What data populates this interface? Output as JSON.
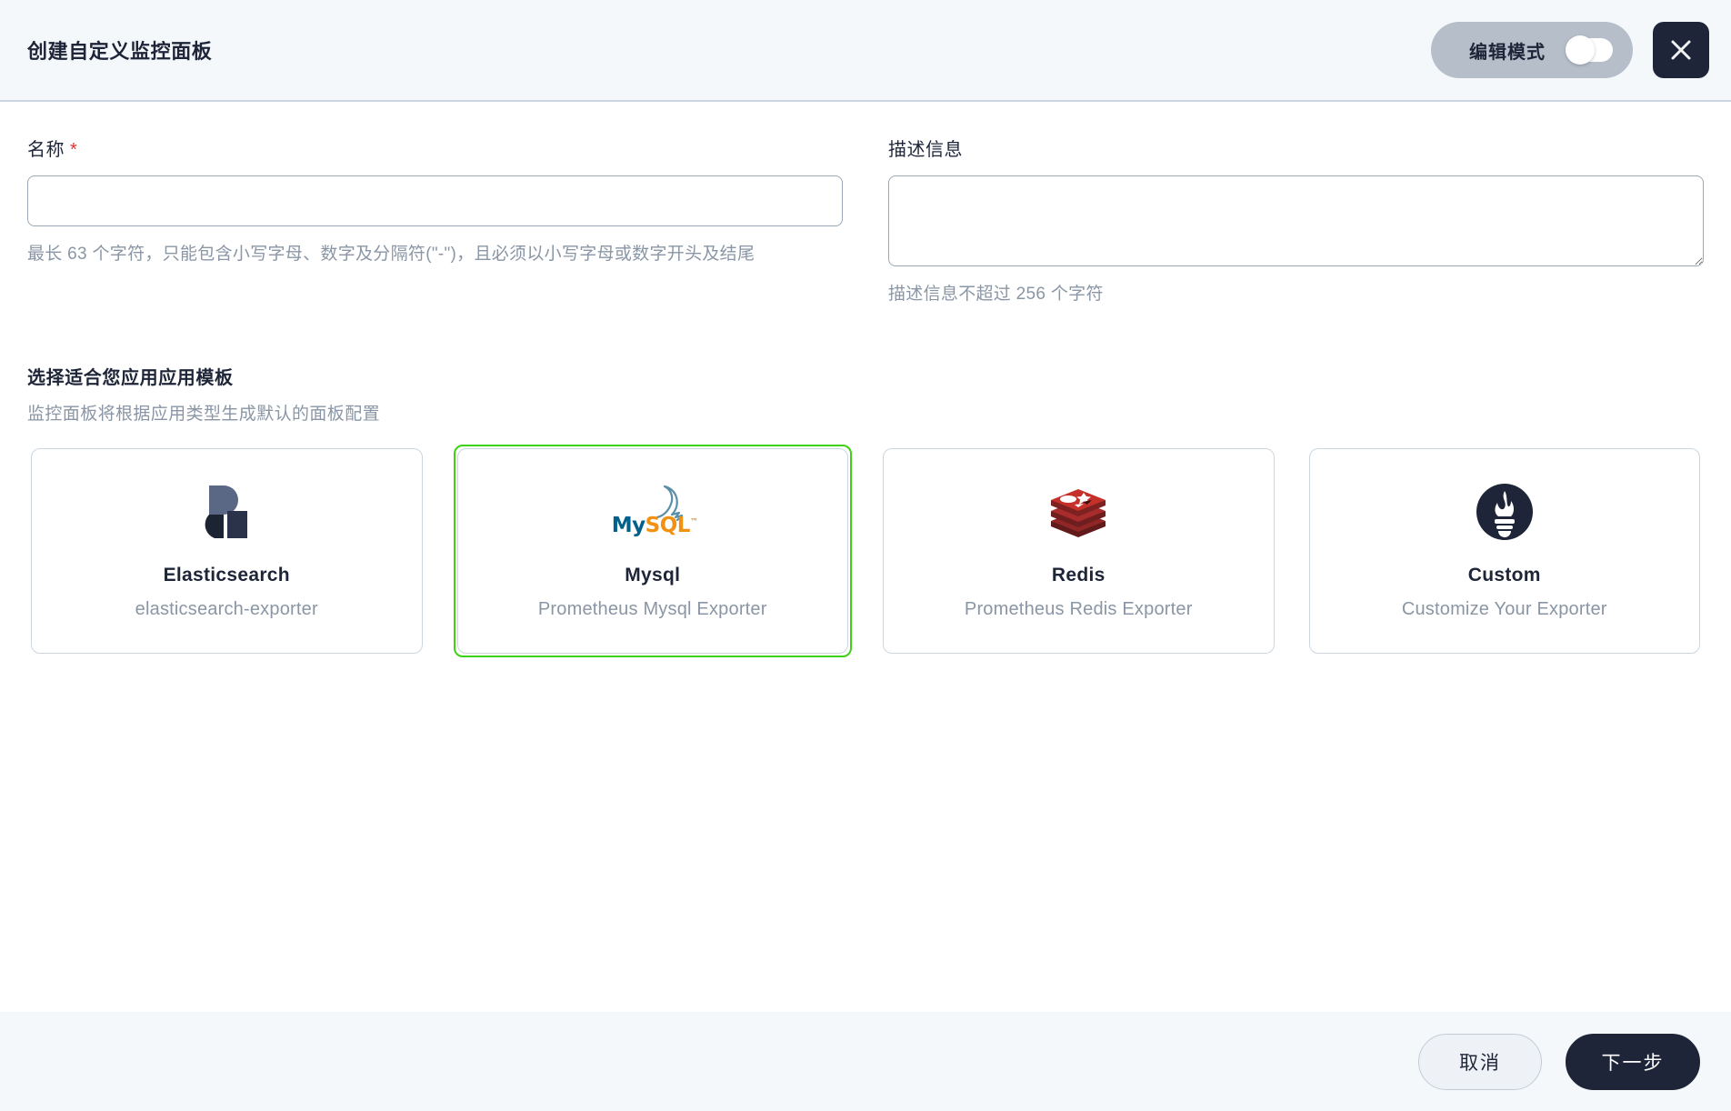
{
  "header": {
    "title": "创建自定义监控面板",
    "edit_mode_label": "编辑模式",
    "edit_mode_enabled": false,
    "close_icon": "close-icon"
  },
  "form": {
    "name": {
      "label": "名称",
      "required_marker": "*",
      "value": "",
      "placeholder": "",
      "helper": "最长 63 个字符，只能包含小写字母、数字及分隔符(\"-\")，且必须以小写字母或数字开头及结尾"
    },
    "description": {
      "label": "描述信息",
      "value": "",
      "placeholder": "",
      "helper": "描述信息不超过 256 个字符"
    }
  },
  "templates": {
    "section_title": "选择适合您应用应用模板",
    "section_subtitle": "监控面板将根据应用类型生成默认的面板配置",
    "selected_index": 1,
    "selection_color": "#3fd114",
    "items": [
      {
        "name": "Elasticsearch",
        "description": "elasticsearch-exporter",
        "logo": "elasticsearch-logo",
        "selected": false
      },
      {
        "name": "Mysql",
        "description": "Prometheus Mysql Exporter",
        "logo": "mysql-logo",
        "logo_text_primary": "My",
        "logo_text_secondary": "SQL",
        "logo_text_tm": "™",
        "selected": true
      },
      {
        "name": "Redis",
        "description": "Prometheus Redis Exporter",
        "logo": "redis-logo",
        "selected": false
      },
      {
        "name": "Custom",
        "description": "Customize Your Exporter",
        "logo": "prometheus-logo",
        "selected": false
      }
    ]
  },
  "footer": {
    "cancel_label": "取消",
    "next_label": "下一步"
  },
  "colors": {
    "header_bg": "#f4f8fb",
    "footer_bg": "#f4f8fb",
    "dark": "#1e2538",
    "muted_text": "#8a96a5",
    "border": "#ccd6e0",
    "required": "#e03131",
    "mysql_blue": "#00618a",
    "mysql_orange": "#f29111",
    "redis_red": "#a32b2b"
  }
}
